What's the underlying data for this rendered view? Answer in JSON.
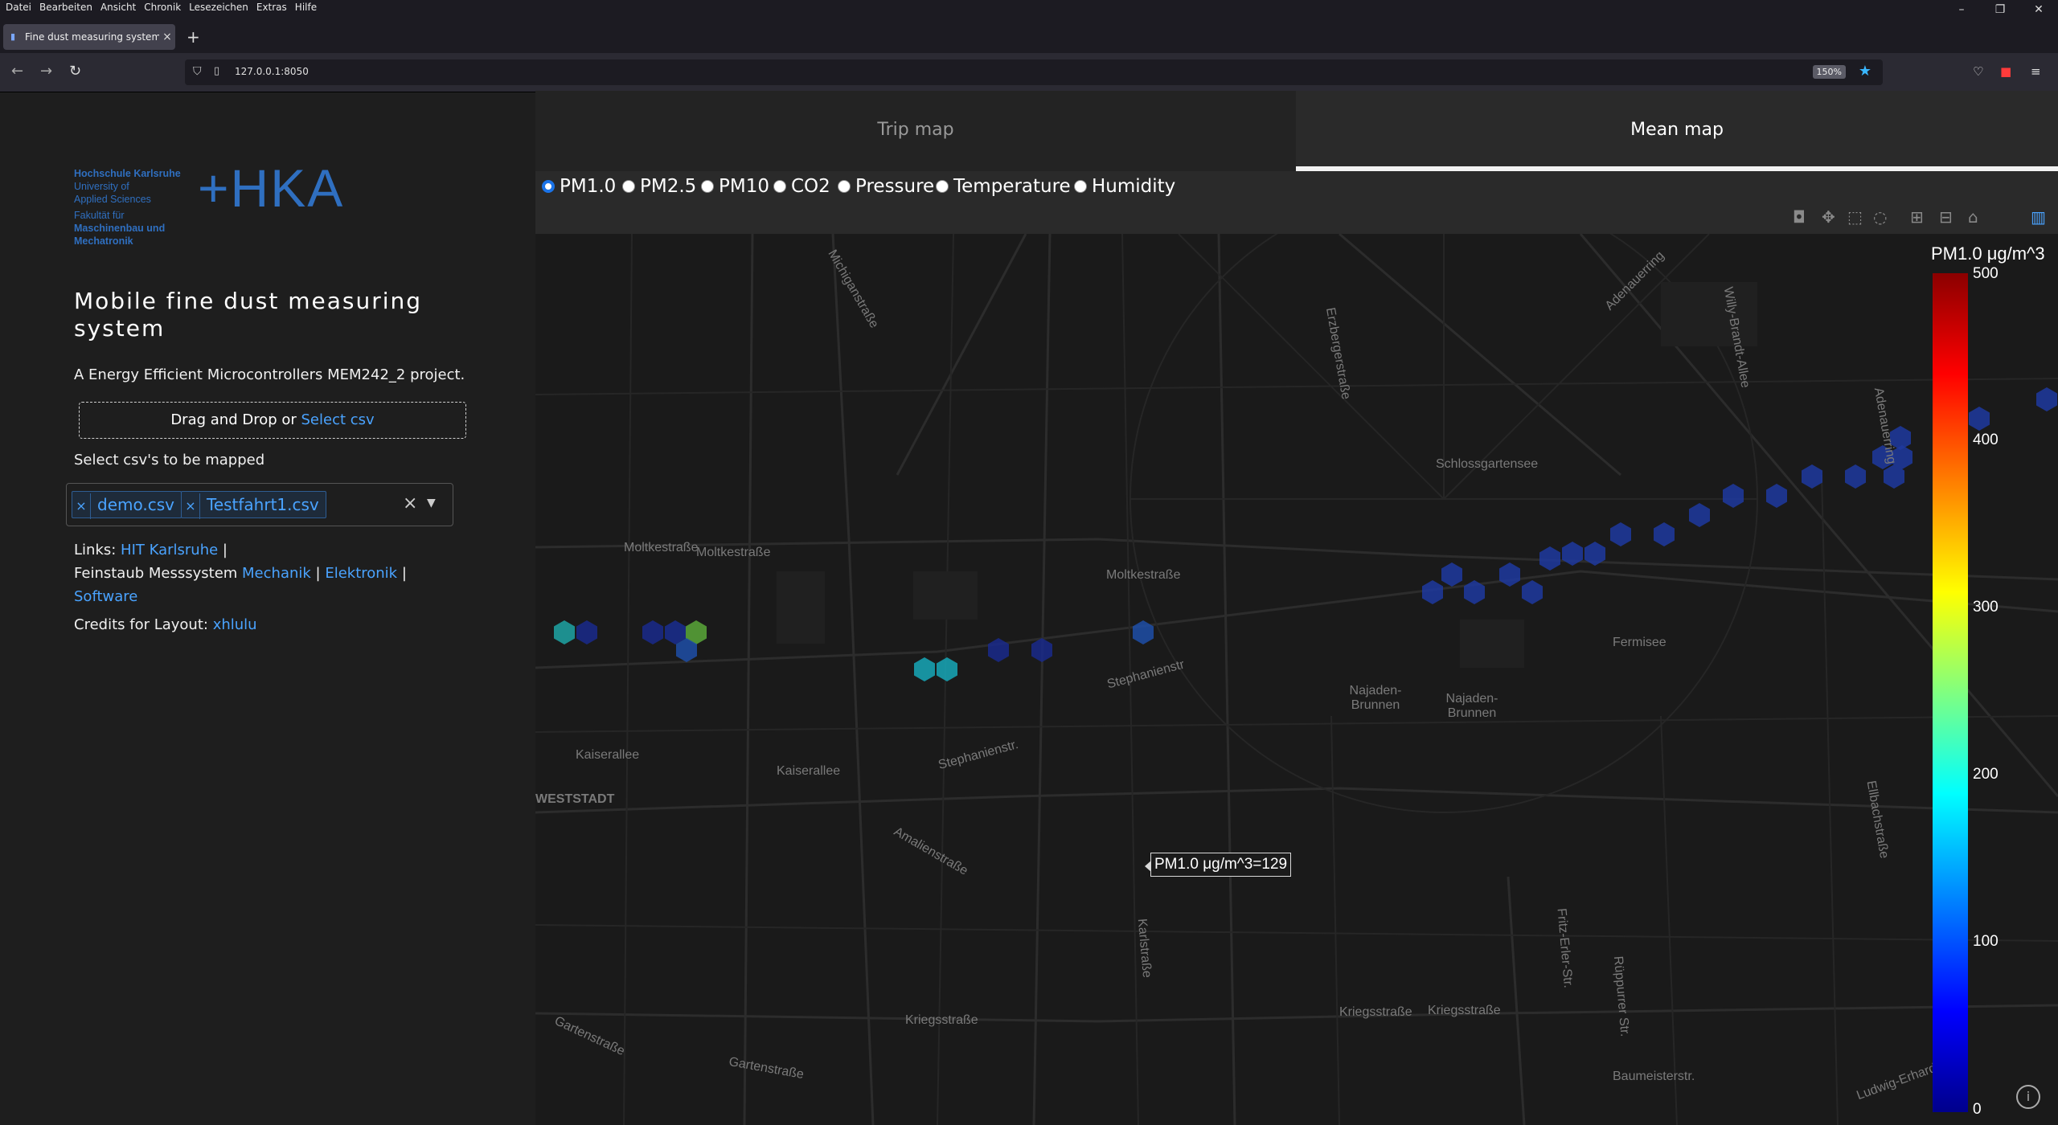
{
  "browser": {
    "menu": [
      "Datei",
      "Bearbeiten",
      "Ansicht",
      "Chronik",
      "Lesezeichen",
      "Extras",
      "Hilfe"
    ],
    "tab_title": "Fine dust measuring system mo",
    "url": "127.0.0.1:8050",
    "zoom": "150%"
  },
  "sidebar": {
    "logo_lines": [
      "Hochschule Karlsruhe",
      "University of",
      "Applied Sciences"
    ],
    "logo_faculty": [
      "Fakultät für",
      "Maschinenbau und",
      "Mechatronik"
    ],
    "logo_mark": "HKA",
    "title": "Mobile fine dust measuring system",
    "subtitle": "A Energy Efficient Microcontrollers MEM242_2 project.",
    "upload_text": "Drag and Drop or ",
    "upload_link": "Select csv",
    "select_label": "Select csv's to be mapped",
    "selected_files": [
      "demo.csv",
      "Testfahrt1.csv"
    ],
    "links_prefix": "Links: ",
    "link_hit": "HIT Karlsruhe",
    "sep": " | ",
    "feinstaub_prefix": "Feinstaub Messsystem ",
    "link_mechanik": "Mechanik",
    "link_elektronik": "Elektronik",
    "link_software": "Software",
    "credits_prefix": "Credits for Layout: ",
    "credits_link": "xhlulu"
  },
  "main": {
    "tabs": [
      "Trip map",
      "Mean map"
    ],
    "active_tab": "Mean map",
    "radios": [
      "PM1.0",
      "PM2.5",
      "PM10",
      "CO2",
      "Pressure",
      "Temperature",
      "Humidity"
    ],
    "selected_radio": "PM1.0",
    "modebar_icons": [
      "camera-icon",
      "pan-icon",
      "box-select-icon",
      "lasso-icon",
      "zoom-in-icon",
      "zoom-out-icon",
      "home-icon",
      "plotly-logo-icon"
    ]
  },
  "map": {
    "street_labels": [
      "Michiganstraße",
      "Adenauerring",
      "Willy-Brandt-Allee",
      "Erzbergerstraße",
      "Moltkestraße",
      "Moltkestraße",
      "Moltkestraße",
      "Schlossgartensee",
      "Kaiserallee",
      "Kaiserallee",
      "WESTSTADT",
      "Stephanienstr.",
      "Stephanienstr",
      "Amalienstraße",
      "Karlstraße",
      "Kriegsstraße",
      "Kriegsstraße",
      "Kriegsstraße",
      "Gartenstraße",
      "Gartenstraße",
      "Najaden-Brunnen",
      "Najaden-Brunnen",
      "Fermisee",
      "Fritz-Erler-Str.",
      "Rüppurrer Str.",
      "Baumeisterstr.",
      "Ludwig-Erhard-Allee",
      "Adenauerring",
      "Ellbachstraße"
    ],
    "tooltip": "PM1.0 μg/m^3=129",
    "colorbar_title": "PM1.0 μg/m^3",
    "colorbar_ticks": [
      "500",
      "400",
      "300",
      "200",
      "100",
      "0"
    ],
    "colorscale": [
      "#00008b",
      "#0000ff",
      "#0080ff",
      "#00ffff",
      "#80ff80",
      "#ffff00",
      "#ff8000",
      "#ff0000",
      "#8b0000"
    ],
    "hexbins": [
      {
        "value": 160,
        "color": "#1fa5a5"
      },
      {
        "value": 95,
        "color": "#1a2a8c"
      },
      {
        "value": 95,
        "color": "#1a2a8c"
      },
      {
        "value": 100,
        "color": "#1a2e90"
      },
      {
        "value": 230,
        "color": "#5aa83a"
      },
      {
        "value": 130,
        "color": "#1f4fa8"
      },
      {
        "value": 175,
        "color": "#18a8b8"
      },
      {
        "value": 175,
        "color": "#18a8b8"
      },
      {
        "value": 95,
        "color": "#1a2a8c"
      },
      {
        "value": 95,
        "color": "#1a2a8c"
      },
      {
        "value": 129,
        "color": "#1f4fa8"
      },
      {
        "value": 110,
        "color": "#1e3aa0"
      },
      {
        "value": 110,
        "color": "#1e3aa0"
      },
      {
        "value": 110,
        "color": "#1e3aa0"
      },
      {
        "value": 110,
        "color": "#1e3aa0"
      },
      {
        "value": 110,
        "color": "#1e3aa0"
      },
      {
        "value": 110,
        "color": "#1e3aa0"
      },
      {
        "value": 110,
        "color": "#1e3aa0"
      },
      {
        "value": 110,
        "color": "#1e3aa0"
      },
      {
        "value": 110,
        "color": "#1e3aa0"
      },
      {
        "value": 110,
        "color": "#1e3aa0"
      },
      {
        "value": 110,
        "color": "#1e3aa0"
      },
      {
        "value": 110,
        "color": "#1e3aa0"
      },
      {
        "value": 110,
        "color": "#1e3aa0"
      },
      {
        "value": 110,
        "color": "#1e3aa0"
      },
      {
        "value": 110,
        "color": "#1e3aa0"
      },
      {
        "value": 110,
        "color": "#1e3aa0"
      },
      {
        "value": 110,
        "color": "#1e3aa0"
      },
      {
        "value": 110,
        "color": "#1e3aa0"
      },
      {
        "value": 110,
        "color": "#1e3aa0"
      },
      {
        "value": 110,
        "color": "#1e3aa0"
      },
      {
        "value": 110,
        "color": "#1e3aa0"
      }
    ]
  }
}
